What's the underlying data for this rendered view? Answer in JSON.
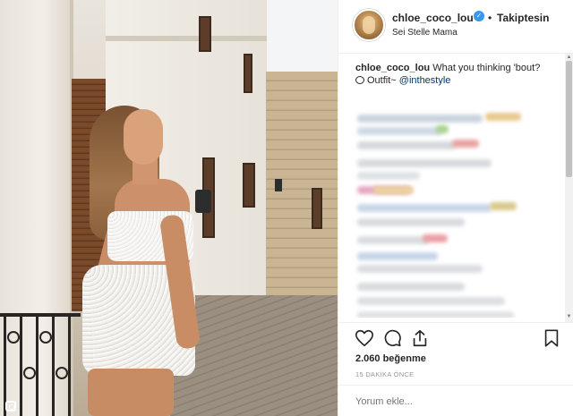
{
  "post": {
    "username": "chloe_coco_lou",
    "follow_separator": "•",
    "follow_state": "Takiptesin",
    "location": "Sei Stelle Mama",
    "caption_user": "chloe_coco_lou",
    "caption_text": "What you thinking 'bout?",
    "caption_line2_prefix": "Outfit~ ",
    "caption_mention": "@inthestyle",
    "likes": "2.060 beğenme",
    "time": "15 DAKİKA ÖNCE",
    "comment_placeholder": "Yorum ekle..."
  },
  "icons": {
    "verified": "verified-badge-icon",
    "like": "heart-icon",
    "comment": "comment-icon",
    "share": "share-icon",
    "save": "bookmark-icon",
    "caption_bubble": "speech-bubble-icon"
  },
  "colors": {
    "verified_blue": "#3897f0",
    "mention": "#003569",
    "meta_gray": "#999999",
    "text": "#262626"
  }
}
